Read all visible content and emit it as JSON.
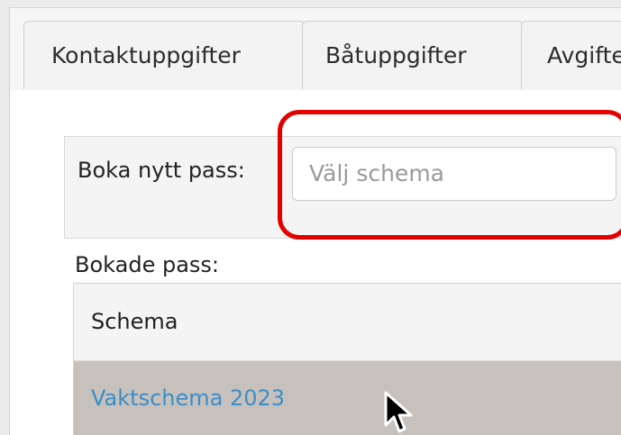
{
  "tabs": [
    {
      "label": "Kontaktuppgifter"
    },
    {
      "label": "Båtuppgifter"
    },
    {
      "label": "Avgifter"
    }
  ],
  "booking": {
    "label": "Boka nytt pass:",
    "select_placeholder": "Välj schema"
  },
  "booked": {
    "label": "Bokade pass:",
    "columns": [
      "Schema"
    ],
    "rows": [
      {
        "schema": "Vaktschema 2023"
      }
    ]
  },
  "colors": {
    "highlight": "#e20000",
    "link": "#3a8ec8",
    "selected_row": "#c7c1bd"
  }
}
